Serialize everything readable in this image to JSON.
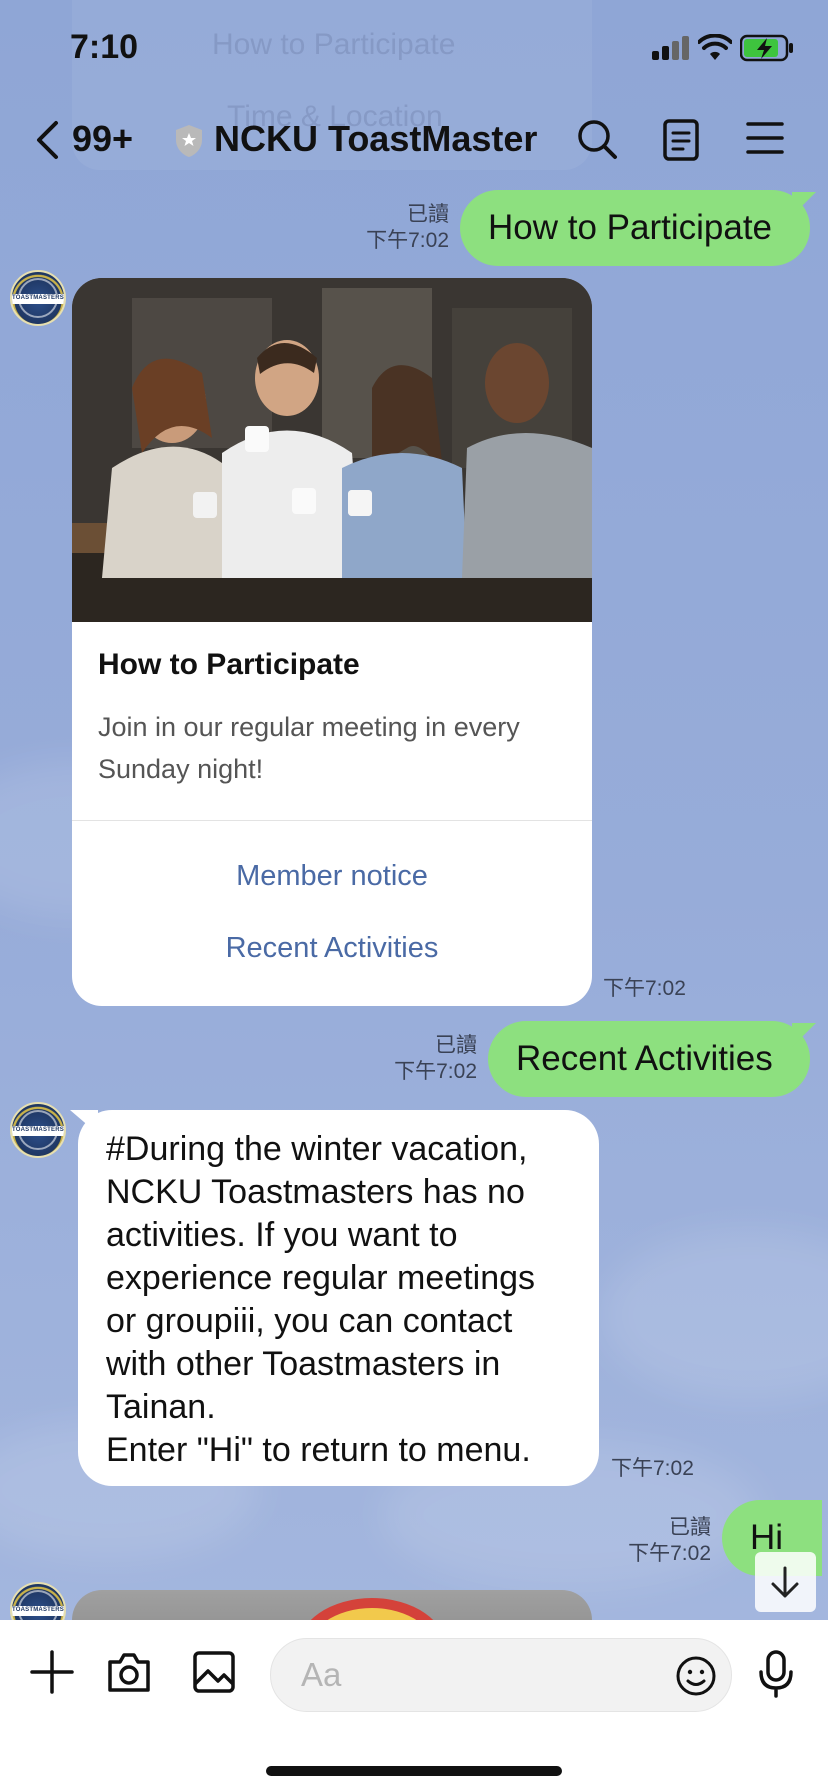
{
  "status_bar": {
    "time": "7:10"
  },
  "ghost_menu": {
    "items": [
      "How to Participate",
      "Time & Location"
    ]
  },
  "header": {
    "unread_count": "99+",
    "room_name": "NCKU ToastMaster"
  },
  "messages": {
    "m1": {
      "read_label": "已讀",
      "time": "下午7:02",
      "text": "How to Participate"
    },
    "card": {
      "title": "How to Participate",
      "description": "Join in our regular meeting in every Sunday night!",
      "actions": [
        "Member notice",
        "Recent Activities"
      ],
      "time": "下午7:02"
    },
    "m2": {
      "read_label": "已讀",
      "time": "下午7:02",
      "text": "Recent Activities"
    },
    "m3": {
      "text": "#During the winter vacation,\nNCKU Toastmasters has no\nactivities. If you want to\nexperience regular meetings\nor groupiii, you can contact\nwith other Toastmasters in\nTainan.\n Enter \"Hi\" to return to menu.",
      "time": "下午7:02"
    },
    "m4": {
      "read_label": "已讀",
      "time": "下午7:02",
      "text": "Hi"
    }
  },
  "composer": {
    "placeholder": "Aa"
  },
  "icons": {
    "back": "chevron-left-icon",
    "shield": "official-shield-icon",
    "search": "search-icon",
    "notes": "notes-icon",
    "menu": "hamburger-menu-icon",
    "plus": "plus-icon",
    "camera": "camera-icon",
    "image": "image-icon",
    "emoji": "emoji-icon",
    "mic": "microphone-icon",
    "scroll_down": "arrow-down-icon"
  },
  "colors": {
    "background": "#93a9d8",
    "outgoing_bubble": "#8de07f",
    "incoming_bubble": "#ffffff",
    "link": "#4a6aa5"
  }
}
